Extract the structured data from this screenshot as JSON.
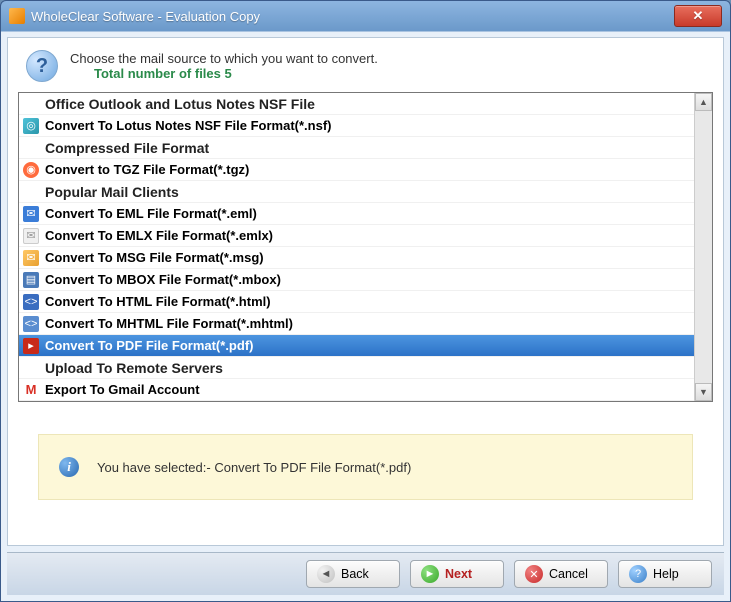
{
  "titlebar": {
    "title": "WholeClear Software - Evaluation Copy"
  },
  "header": {
    "instruction": "Choose the mail source to which you want to convert.",
    "subline": "Total number of files 5"
  },
  "list": {
    "rows": [
      {
        "type": "group",
        "label": "Office Outlook and Lotus Notes NSF File"
      },
      {
        "type": "item",
        "icon": "nsf",
        "label": "Convert To Lotus Notes NSF File Format(*.nsf)"
      },
      {
        "type": "group",
        "label": "Compressed File Format"
      },
      {
        "type": "item",
        "icon": "tgz",
        "label": "Convert to TGZ File Format(*.tgz)"
      },
      {
        "type": "group",
        "label": "Popular Mail Clients"
      },
      {
        "type": "item",
        "icon": "eml",
        "label": "Convert To EML File Format(*.eml)"
      },
      {
        "type": "item",
        "icon": "emlx",
        "label": "Convert To EMLX File Format(*.emlx)"
      },
      {
        "type": "item",
        "icon": "msg",
        "label": "Convert To MSG File Format(*.msg)"
      },
      {
        "type": "item",
        "icon": "mbox",
        "label": "Convert To MBOX File Format(*.mbox)"
      },
      {
        "type": "item",
        "icon": "html",
        "label": "Convert To HTML File Format(*.html)"
      },
      {
        "type": "item",
        "icon": "mhtml",
        "label": "Convert To MHTML File Format(*.mhtml)"
      },
      {
        "type": "item",
        "icon": "pdf",
        "label": "Convert To PDF File Format(*.pdf)",
        "selected": true
      },
      {
        "type": "group",
        "label": "Upload To Remote Servers"
      },
      {
        "type": "item",
        "icon": "gmail",
        "label": "Export To Gmail Account"
      }
    ]
  },
  "info": {
    "text": "You have selected:- Convert To PDF File Format(*.pdf)"
  },
  "buttons": {
    "back": "Back",
    "next": "Next",
    "cancel": "Cancel",
    "help": "Help"
  }
}
